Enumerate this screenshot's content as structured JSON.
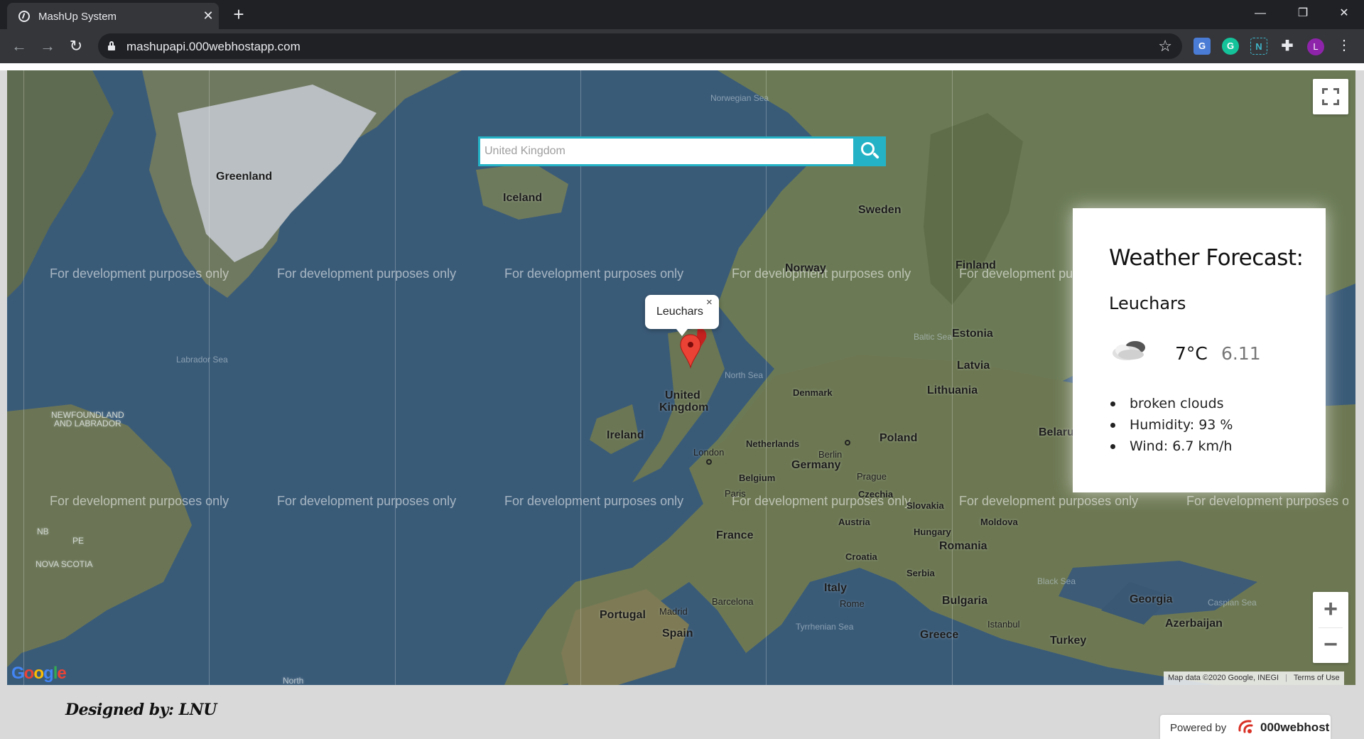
{
  "browser": {
    "tab_title": "MashUp System",
    "tab_close": "✕",
    "new_tab": "+",
    "url": "mashupapi.000webhostapp.com",
    "window_controls": {
      "minimize": "—",
      "restore": "❐",
      "close": "✕"
    },
    "extensions": {
      "translate": "G",
      "grammarly": "G",
      "n_ext": "N",
      "puzzle": "✚",
      "avatar_letter": "L"
    },
    "menu": "⋮",
    "back": "←",
    "forward": "→",
    "reload": "↻",
    "star": "☆"
  },
  "search": {
    "placeholder": "United Kingdom",
    "value": ""
  },
  "map": {
    "watermark": "For development purposes only",
    "marker_popup": "Leuchars",
    "popup_close": "×",
    "attribution": "Map data ©2020 Google, INEGI",
    "terms": "Terms of Use",
    "zoom_in": "+",
    "zoom_out": "−",
    "logo": "Google",
    "places": {
      "greenland": "Greenland",
      "iceland": "Iceland",
      "sweden": "Sweden",
      "norway": "Norway",
      "finland": "Finland",
      "estonia": "Estonia",
      "latvia": "Latvia",
      "lithuania": "Lithuania",
      "denmark": "Denmark",
      "uk_line1": "United",
      "uk_line2": "Kingdom",
      "ireland": "Ireland",
      "london": "London",
      "netherlands": "Netherlands",
      "berlin": "Berlin",
      "germany": "Germany",
      "belgium": "Belgium",
      "poland": "Poland",
      "belarus": "Belarus",
      "prague": "Prague",
      "czechia": "Czechia",
      "slovakia": "Slovakia",
      "paris": "Paris",
      "austria": "Austria",
      "moldova": "Moldova",
      "hungary": "Hungary",
      "france": "France",
      "romania": "Romania",
      "croatia": "Croatia",
      "serbia": "Serbia",
      "italy": "Italy",
      "rome": "Rome",
      "bulgaria": "Bulgaria",
      "barcelona": "Barcelona",
      "portugal": "Portugal",
      "madrid": "Madrid",
      "spain": "Spain",
      "greece": "Greece",
      "turkey": "Turkey",
      "georgia": "Georgia",
      "azerbaijan": "Azerbaijan",
      "istanbul": "Istanbul",
      "newfoundland_1": "NEWFOUNDLAND",
      "newfoundland_2": "AND LABRADOR",
      "nova_scotia": "NOVA SCOTIA",
      "nb": "NB",
      "pe": "PE",
      "north": "North"
    },
    "seas": {
      "norwegian": "Norwegian Sea",
      "labrador": "Labrador Sea",
      "north_sea": "North Sea",
      "baltic": "Baltic Sea",
      "black": "Black Sea",
      "caspian": "Caspian Sea",
      "tyrrhenian": "Tyrrhenian Sea"
    }
  },
  "weather": {
    "heading": "Weather Forecast:",
    "city": "Leuchars",
    "temperature": "7°C",
    "feels_like": "6.11",
    "icon": "cloud-icon",
    "details": [
      "broken clouds",
      "Humidity: 93 %",
      "Wind: 6.7 km/h"
    ]
  },
  "footer": {
    "designed_by": "Designed by: LNU",
    "powered_by_label": "Powered by",
    "powered_by_brand": "000webhost"
  },
  "colors": {
    "accent": "#24b3c6",
    "marker": "#ea4335",
    "chrome_dark": "#202124",
    "chrome_mid": "#35363a"
  }
}
